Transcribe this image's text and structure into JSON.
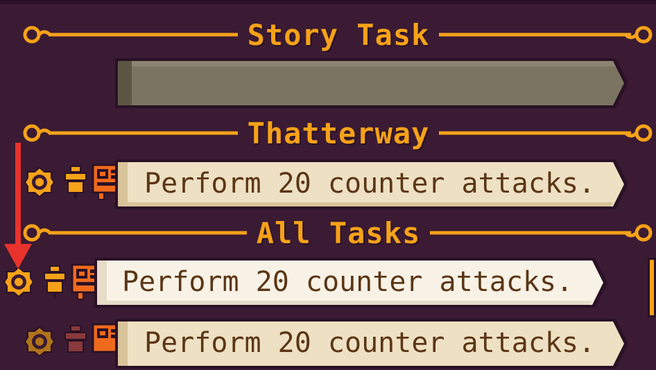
{
  "sections": {
    "story": {
      "title": "Story Task"
    },
    "region": {
      "title": "Thatterway"
    },
    "all": {
      "title": "All Tasks"
    }
  },
  "tasks": [
    {
      "text": "Perform 20 counter attacks.",
      "group": "region",
      "highlighted": false
    },
    {
      "text": "Perform 20 counter attacks.",
      "group": "all",
      "highlighted": true
    },
    {
      "text": "Perform 20 counter attacks.",
      "group": "all",
      "highlighted": false
    }
  ],
  "icons": {
    "task_type": "gear-target-icon",
    "reward_type": "lantern-icon",
    "board_type": "notice-board-icon"
  },
  "colors": {
    "accent": "#f6a219",
    "background": "#3a1b33",
    "parchment": "#eee0c3",
    "parchment_highlight": "#f8f2e6",
    "empty_bar": "#7a7461",
    "text": "#5b3616",
    "annotation_arrow": "#e8332c"
  }
}
